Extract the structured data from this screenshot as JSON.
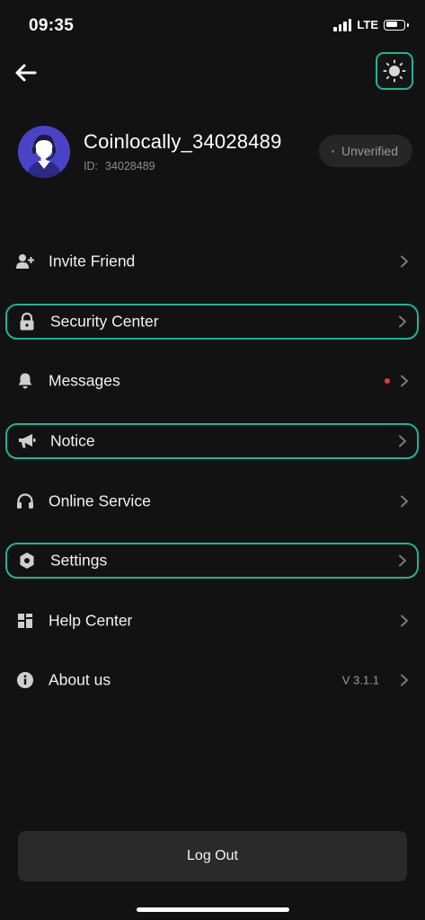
{
  "status_bar": {
    "time": "09:35",
    "network": "LTE"
  },
  "header": {
    "back_icon": "arrow-left-icon",
    "theme_icon": "sun-icon"
  },
  "profile": {
    "username": "Coinlocally_34028489",
    "id_label": "ID:",
    "id_value": "34028489",
    "verification_status": "Unverified"
  },
  "menu": {
    "items": [
      {
        "label": "Invite Friend",
        "icon": "add-user-icon"
      },
      {
        "label": "Security Center",
        "icon": "lock-icon"
      },
      {
        "label": "Messages",
        "icon": "bell-icon"
      },
      {
        "label": "Notice",
        "icon": "megaphone-icon"
      },
      {
        "label": "Online Service",
        "icon": "headphones-icon"
      },
      {
        "label": "Settings",
        "icon": "hexagon-settings-icon"
      },
      {
        "label": "Help Center",
        "icon": "grid-icon"
      },
      {
        "label": "About us",
        "icon": "info-icon",
        "version": "V 3.1.1"
      }
    ]
  },
  "logout_label": "Log Out",
  "colors": {
    "background": "#121212",
    "highlight": "#1bb59a",
    "unread_dot": "#e53935",
    "avatar_bg": "#4b43c6"
  }
}
